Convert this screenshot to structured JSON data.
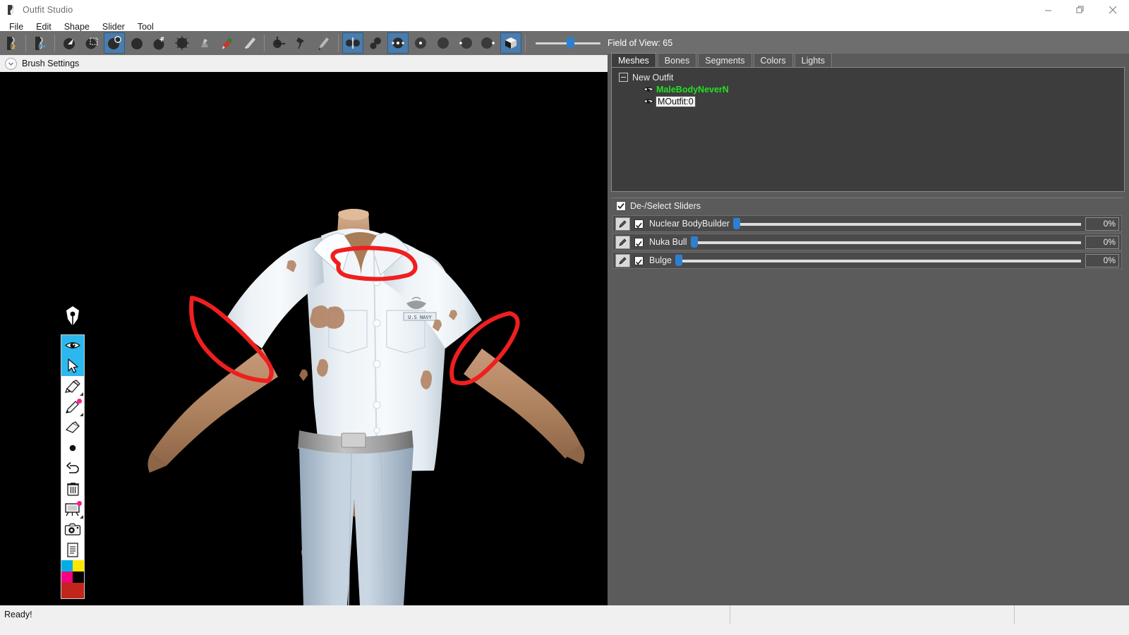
{
  "window": {
    "title": "Outfit Studio",
    "app_icon": "outfit-studio-icon",
    "minimize": "—",
    "maximize": "❐",
    "close": "✕"
  },
  "menubar": {
    "items": [
      {
        "label": "File"
      },
      {
        "label": "Edit"
      },
      {
        "label": "Shape"
      },
      {
        "label": "Slider"
      },
      {
        "label": "Tool"
      }
    ]
  },
  "toolbar": {
    "buttons": [
      {
        "name": "new-project-icon",
        "active": false
      },
      {
        "name": "load-project-icon",
        "active": false
      },
      {
        "name": "select-vertices-icon",
        "active": false
      },
      {
        "name": "box-select-icon",
        "active": false
      },
      {
        "name": "mask-brush-icon",
        "active": true
      },
      {
        "name": "unmask-brush-icon",
        "active": false
      },
      {
        "name": "move-brush-icon",
        "active": false
      },
      {
        "name": "inflate-brush-icon",
        "active": false
      },
      {
        "name": "smooth-brush-icon",
        "active": false
      },
      {
        "name": "weight-brush-icon",
        "active": false
      },
      {
        "name": "color-brush-icon",
        "active": false
      },
      {
        "name": "transform-icon",
        "active": false
      },
      {
        "name": "pivot-icon",
        "active": false
      },
      {
        "name": "vertex-edit-icon",
        "active": false
      },
      {
        "name": "show-wireframe-icon",
        "active": true
      },
      {
        "name": "show-seams-icon",
        "active": false
      },
      {
        "name": "show-normals-icon",
        "active": true
      },
      {
        "name": "lighting-1-icon",
        "active": false
      },
      {
        "name": "lighting-2-icon",
        "active": false
      },
      {
        "name": "lighting-3-icon",
        "active": false
      },
      {
        "name": "lighting-4-icon",
        "active": false
      },
      {
        "name": "show-textures-icon",
        "active": true
      }
    ],
    "fov_label": "Field of View: 65",
    "fov_value": 65,
    "fov_min": 0,
    "fov_max": 100
  },
  "brush_settings": {
    "label": "Brush Settings",
    "collapse_icon": "chevron-down-icon",
    "expanded": false
  },
  "annotation_palette": {
    "cursor_icon": "pen-nib-cursor",
    "tools": [
      {
        "name": "visibility-toggle-icon",
        "selected": true,
        "badge": false,
        "corner": false
      },
      {
        "name": "pointer-select-icon",
        "selected": true,
        "badge": false,
        "corner": false
      },
      {
        "name": "highlighter-icon",
        "selected": false,
        "badge": false,
        "corner": true
      },
      {
        "name": "pen-icon",
        "selected": false,
        "badge": true,
        "corner": true
      },
      {
        "name": "eraser-icon",
        "selected": false,
        "badge": false,
        "corner": false
      },
      {
        "name": "dot-brush-icon",
        "selected": false,
        "badge": false,
        "corner": false
      },
      {
        "name": "undo-icon",
        "selected": false,
        "badge": false,
        "corner": false
      },
      {
        "name": "trash-icon",
        "selected": false,
        "badge": false,
        "corner": false
      },
      {
        "name": "whiteboard-icon",
        "selected": false,
        "badge": true,
        "corner": true
      },
      {
        "name": "camera-icon",
        "selected": false,
        "badge": false,
        "corner": false
      },
      {
        "name": "clipboard-icon",
        "selected": false,
        "badge": false,
        "corner": false
      }
    ],
    "swatches": [
      "#00aee6",
      "#ffe600",
      "#f5007f",
      "#000000"
    ],
    "current_color": "#c2251b"
  },
  "right_panel": {
    "tabs": [
      {
        "label": "Meshes",
        "active": true
      },
      {
        "label": "Bones",
        "active": false
      },
      {
        "label": "Segments",
        "active": false
      },
      {
        "label": "Colors",
        "active": false
      },
      {
        "label": "Lights",
        "active": false
      }
    ],
    "tree": {
      "root": {
        "label": "New Outfit",
        "expander_icon": "collapse-box-icon"
      },
      "children": [
        {
          "label": "MaleBodyNeverN",
          "eye_icon": "eye-visible-icon",
          "state": "highlight-green"
        },
        {
          "label": "MOutfit:0",
          "eye_icon": "eye-visible-icon",
          "state": "selected"
        }
      ]
    }
  },
  "sliders_panel": {
    "deselect_label": "De-/Select Sliders",
    "deselect_checked": true,
    "sliders": [
      {
        "name": "Nuclear BodyBuilder",
        "value": "0%",
        "position": 0.5,
        "checked": true,
        "edit_icon": "pencil-icon"
      },
      {
        "name": "Nuka Bull",
        "value": "0%",
        "position": 0.5,
        "checked": true,
        "edit_icon": "pencil-icon"
      },
      {
        "name": "Bulge",
        "value": "0%",
        "position": 0.5,
        "checked": true,
        "edit_icon": "pencil-icon"
      }
    ]
  },
  "viewport": {
    "background": "#000000",
    "model_description": "U.S. Navy white short-sleeve uniform shirt with light blue trousers on male body",
    "annotations": [
      {
        "name": "collar-annotation-circle",
        "color": "#ef1f1f"
      },
      {
        "name": "left-sleeve-annotation-circle",
        "color": "#ef1f1f"
      },
      {
        "name": "right-sleeve-annotation-circle",
        "color": "#ef1f1f"
      }
    ]
  },
  "statusbar": {
    "message": "Ready!",
    "cell_2": "",
    "cell_3": ""
  }
}
